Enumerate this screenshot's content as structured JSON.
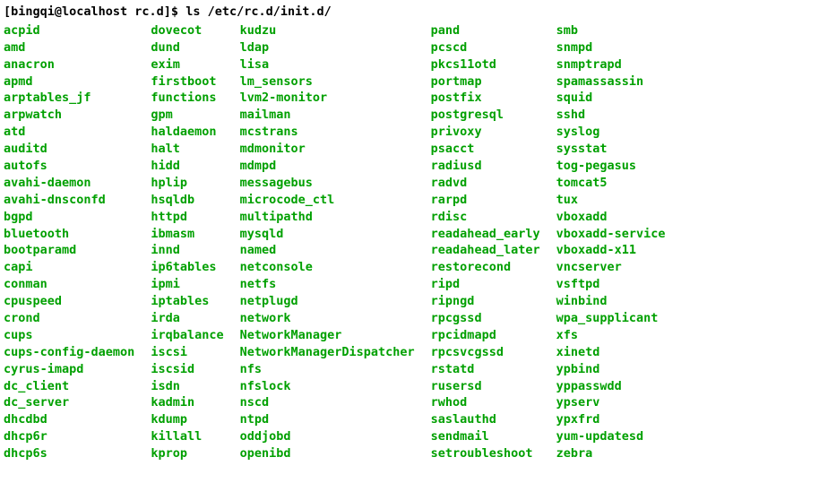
{
  "prompt": {
    "user_host_cwd": "[bingqi@localhost rc.d]$ ",
    "command": "ls /etc/rc.d/init.d/"
  },
  "columns": [
    [
      "acpid",
      "amd",
      "anacron",
      "apmd",
      "arptables_jf",
      "arpwatch",
      "atd",
      "auditd",
      "autofs",
      "avahi-daemon",
      "avahi-dnsconfd",
      "bgpd",
      "bluetooth",
      "bootparamd",
      "capi",
      "conman",
      "cpuspeed",
      "crond",
      "cups",
      "cups-config-daemon",
      "cyrus-imapd",
      "dc_client",
      "dc_server",
      "dhcdbd",
      "dhcp6r",
      "dhcp6s"
    ],
    [
      "dovecot",
      "dund",
      "exim",
      "firstboot",
      "functions",
      "gpm",
      "haldaemon",
      "halt",
      "hidd",
      "hplip",
      "hsqldb",
      "httpd",
      "ibmasm",
      "innd",
      "ip6tables",
      "ipmi",
      "iptables",
      "irda",
      "irqbalance",
      "iscsi",
      "iscsid",
      "isdn",
      "kadmin",
      "kdump",
      "killall",
      "kprop"
    ],
    [
      "kudzu",
      "ldap",
      "lisa",
      "lm_sensors",
      "lvm2-monitor",
      "mailman",
      "mcstrans",
      "mdmonitor",
      "mdmpd",
      "messagebus",
      "microcode_ctl",
      "multipathd",
      "mysqld",
      "named",
      "netconsole",
      "netfs",
      "netplugd",
      "network",
      "NetworkManager",
      "NetworkManagerDispatcher",
      "nfs",
      "nfslock",
      "nscd",
      "ntpd",
      "oddjobd",
      "openibd"
    ],
    [
      "pand",
      "pcscd",
      "pkcs11otd",
      "portmap",
      "postfix",
      "postgresql",
      "privoxy",
      "psacct",
      "radiusd",
      "radvd",
      "rarpd",
      "rdisc",
      "readahead_early",
      "readahead_later",
      "restorecond",
      "ripd",
      "ripngd",
      "rpcgssd",
      "rpcidmapd",
      "rpcsvcgssd",
      "rstatd",
      "rusersd",
      "rwhod",
      "saslauthd",
      "sendmail",
      "setroubleshoot"
    ],
    [
      "smb",
      "snmpd",
      "snmptrapd",
      "spamassassin",
      "squid",
      "sshd",
      "syslog",
      "sysstat",
      "tog-pegasus",
      "tomcat5",
      "tux",
      "vboxadd",
      "vboxadd-service",
      "vboxadd-x11",
      "vncserver",
      "vsftpd",
      "winbind",
      "wpa_supplicant",
      "xfs",
      "xinetd",
      "ypbind",
      "yppasswdd",
      "ypserv",
      "ypxfrd",
      "yum-updatesd",
      "zebra"
    ]
  ]
}
